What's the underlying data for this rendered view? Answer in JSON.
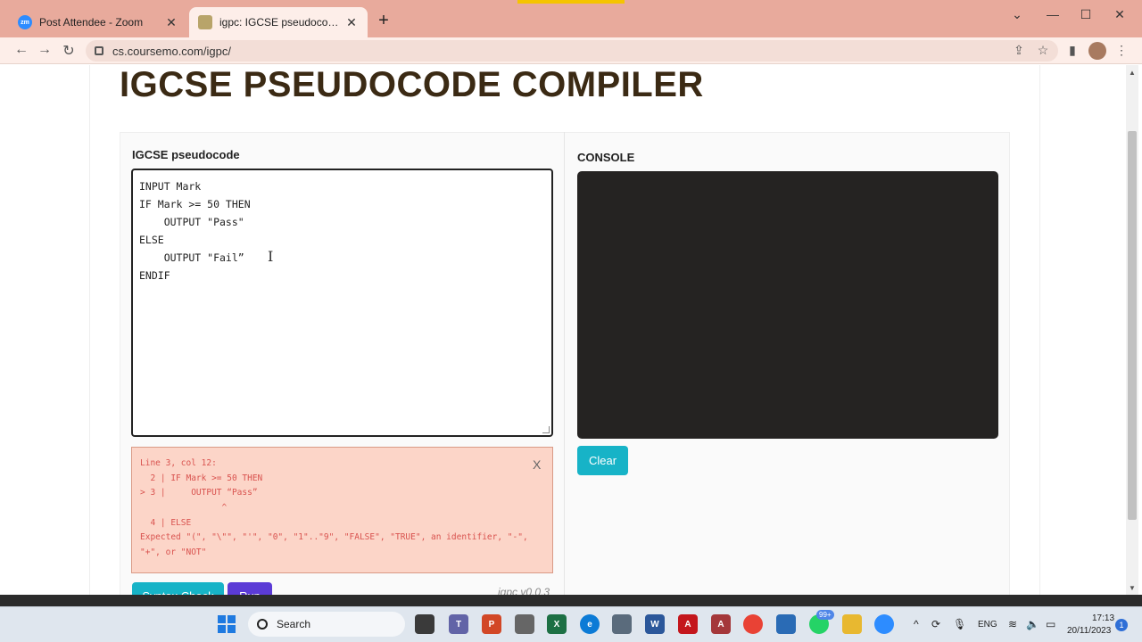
{
  "browser": {
    "tabs": [
      {
        "title": "Post Attendee - Zoom",
        "favicon": "zoom-icon",
        "active": false
      },
      {
        "title": "igpc: IGCSE pseudocode compil",
        "favicon": "igpc-icon",
        "active": true
      }
    ],
    "url": "cs.coursemo.com/igpc/"
  },
  "page": {
    "title": "IGCSE PSEUDOCODE COMPILER",
    "editor_label": "IGCSE pseudocode",
    "code_lines": [
      "INPUT Mark",
      "IF Mark >= 50 THEN",
      "    OUTPUT \"Pass\"",
      "ELSE",
      "    OUTPUT \"Fail”",
      "ENDIF"
    ],
    "error": {
      "lines": [
        "Line 3, col 12:",
        "  2 | IF Mark >= 50 THEN",
        "> 3 |     OUTPUT “Pass”",
        "                ^",
        "  4 | ELSE",
        "Expected \"(\", \"\\\"\", \"'\", \"0\", \"1\"..\"9\", \"FALSE\", \"TRUE\", an identifier, \"-\",",
        "\"+\", or \"NOT\""
      ],
      "close_label": "X"
    },
    "syntax_check_label": "Syntax Check",
    "run_label": "Run",
    "version": "igpc v0.0.3",
    "console_label": "CONSOLE",
    "clear_label": "Clear"
  },
  "taskbar": {
    "search_label": "Search",
    "badge": "99+",
    "lang": "ENG",
    "time": "17:13",
    "date": "20/11/2023",
    "notifications": "1"
  },
  "colors": {
    "tabbar": "#e8aa9c",
    "title": "#3b2a14",
    "error_bg": "#fcd5c8",
    "error_text": "#d9534f",
    "teal_button": "#17b3c7",
    "run_button": "#5b3bd6",
    "console_bg": "#252322"
  }
}
